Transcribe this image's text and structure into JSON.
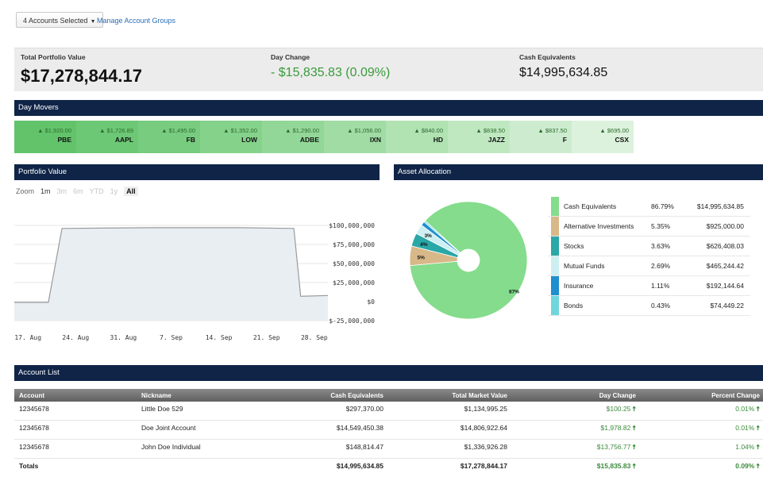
{
  "toolbar": {
    "accounts_selected": "4 Accounts Selected",
    "manage_link": "Manage Account Groups"
  },
  "summary": {
    "total_label": "Total Portfolio Value",
    "total_value": "$17,278,844.17",
    "day_change_label": "Day Change",
    "day_change_value": "- $15,835.83 (0.09%)",
    "cash_label": "Cash Equivalents",
    "cash_value": "$14,995,634.85"
  },
  "sections": {
    "day_movers": "Day Movers",
    "portfolio_value": "Portfolio Value",
    "asset_allocation": "Asset Allocation",
    "account_list": "Account List"
  },
  "movers": [
    {
      "change": "▲ $1,920.00",
      "symbol": "PBE",
      "color": "#62c36b"
    },
    {
      "change": "▲ $1,726.89",
      "symbol": "AAPL",
      "color": "#6cc874"
    },
    {
      "change": "▲ $1,495.00",
      "symbol": "FB",
      "color": "#78cc80"
    },
    {
      "change": "▲ $1,352.00",
      "symbol": "LOW",
      "color": "#85d28b"
    },
    {
      "change": "▲ $1,290.00",
      "symbol": "ADBE",
      "color": "#92d797"
    },
    {
      "change": "▲ $1,056.00",
      "symbol": "IXN",
      "color": "#a0dca4"
    },
    {
      "change": "▲ $840.00",
      "symbol": "HD",
      "color": "#b0e2b2"
    },
    {
      "change": "▲ $838.50",
      "symbol": "JAZZ",
      "color": "#bfe8c1"
    },
    {
      "change": "▲ $837.50",
      "symbol": "F",
      "color": "#cdeccf"
    },
    {
      "change": "▲ $695.00",
      "symbol": "CSX",
      "color": "#dcf2dd"
    }
  ],
  "zoom": {
    "label": "Zoom",
    "options": [
      "1m",
      "3m",
      "6m",
      "YTD",
      "1y",
      "All"
    ],
    "active": "All"
  },
  "chart_data": {
    "type": "area",
    "title": "",
    "x_ticks": [
      "17. Aug",
      "24. Aug",
      "31. Aug",
      "7. Sep",
      "14. Sep",
      "21. Sep",
      "28. Sep"
    ],
    "y_ticks": [
      "$100,000,000",
      "$75,000,000",
      "$50,000,000",
      "$25,000,000",
      "$0",
      "$-25,000,000"
    ],
    "ylim": [
      -25000000,
      100000000
    ],
    "x": [
      "Aug 15",
      "Aug 20",
      "Aug 22",
      "Sep 4",
      "Sep 17",
      "Sep 25",
      "Sep 26",
      "Sep 30"
    ],
    "values": [
      -1000000,
      -1000000,
      96000000,
      97000000,
      97000000,
      96000000,
      7000000,
      8000000
    ]
  },
  "allocation": {
    "slices": [
      {
        "name": "Cash Equivalents",
        "percent": "86.79%",
        "amount": "$14,995,634.85",
        "value": 86.79,
        "label": "87%",
        "color": "#84dc8c"
      },
      {
        "name": "Alternative Investments",
        "percent": "5.35%",
        "amount": "$925,000.00",
        "value": 5.35,
        "label": "5%",
        "color": "#d8b889"
      },
      {
        "name": "Stocks",
        "percent": "3.63%",
        "amount": "$626,408.03",
        "value": 3.63,
        "label": "4%",
        "color": "#2aa7a7"
      },
      {
        "name": "Mutual Funds",
        "percent": "2.69%",
        "amount": "$465,244.42",
        "value": 2.69,
        "label": "3%",
        "color": "#cdeff2"
      },
      {
        "name": "Insurance",
        "percent": "1.11%",
        "amount": "$192,144.64",
        "value": 1.11,
        "label": "",
        "color": "#1e8fcf"
      },
      {
        "name": "Bonds",
        "percent": "0.43%",
        "amount": "$74,449.22",
        "value": 0.43,
        "label": "",
        "color": "#6fd6dc"
      }
    ]
  },
  "account_table": {
    "headers": [
      "Account",
      "Nickname",
      "Cash Equivalents",
      "Total Market Value",
      "Day Change",
      "Percent Change"
    ],
    "rows": [
      {
        "account": "12345678",
        "nickname": "Little Doe 529",
        "cash": "$297,370.00",
        "market": "$1,134,995.25",
        "day_change": "$100.25",
        "percent": "0.01%"
      },
      {
        "account": "12345678",
        "nickname": "Doe Joint Account",
        "cash": "$14,549,450.38",
        "market": "$14,806,922.64",
        "day_change": "$1,978.82",
        "percent": "0.01%"
      },
      {
        "account": "12345678",
        "nickname": "John Doe Individual",
        "cash": "$148,814.47",
        "market": "$1,336,926.28",
        "day_change": "$13,756.77",
        "percent": "1.04%"
      }
    ],
    "totals": {
      "label": "Totals",
      "cash": "$14,995,634.85",
      "market": "$17,278,844.17",
      "day_change": "$15,835.83",
      "percent": "0.09%"
    }
  }
}
